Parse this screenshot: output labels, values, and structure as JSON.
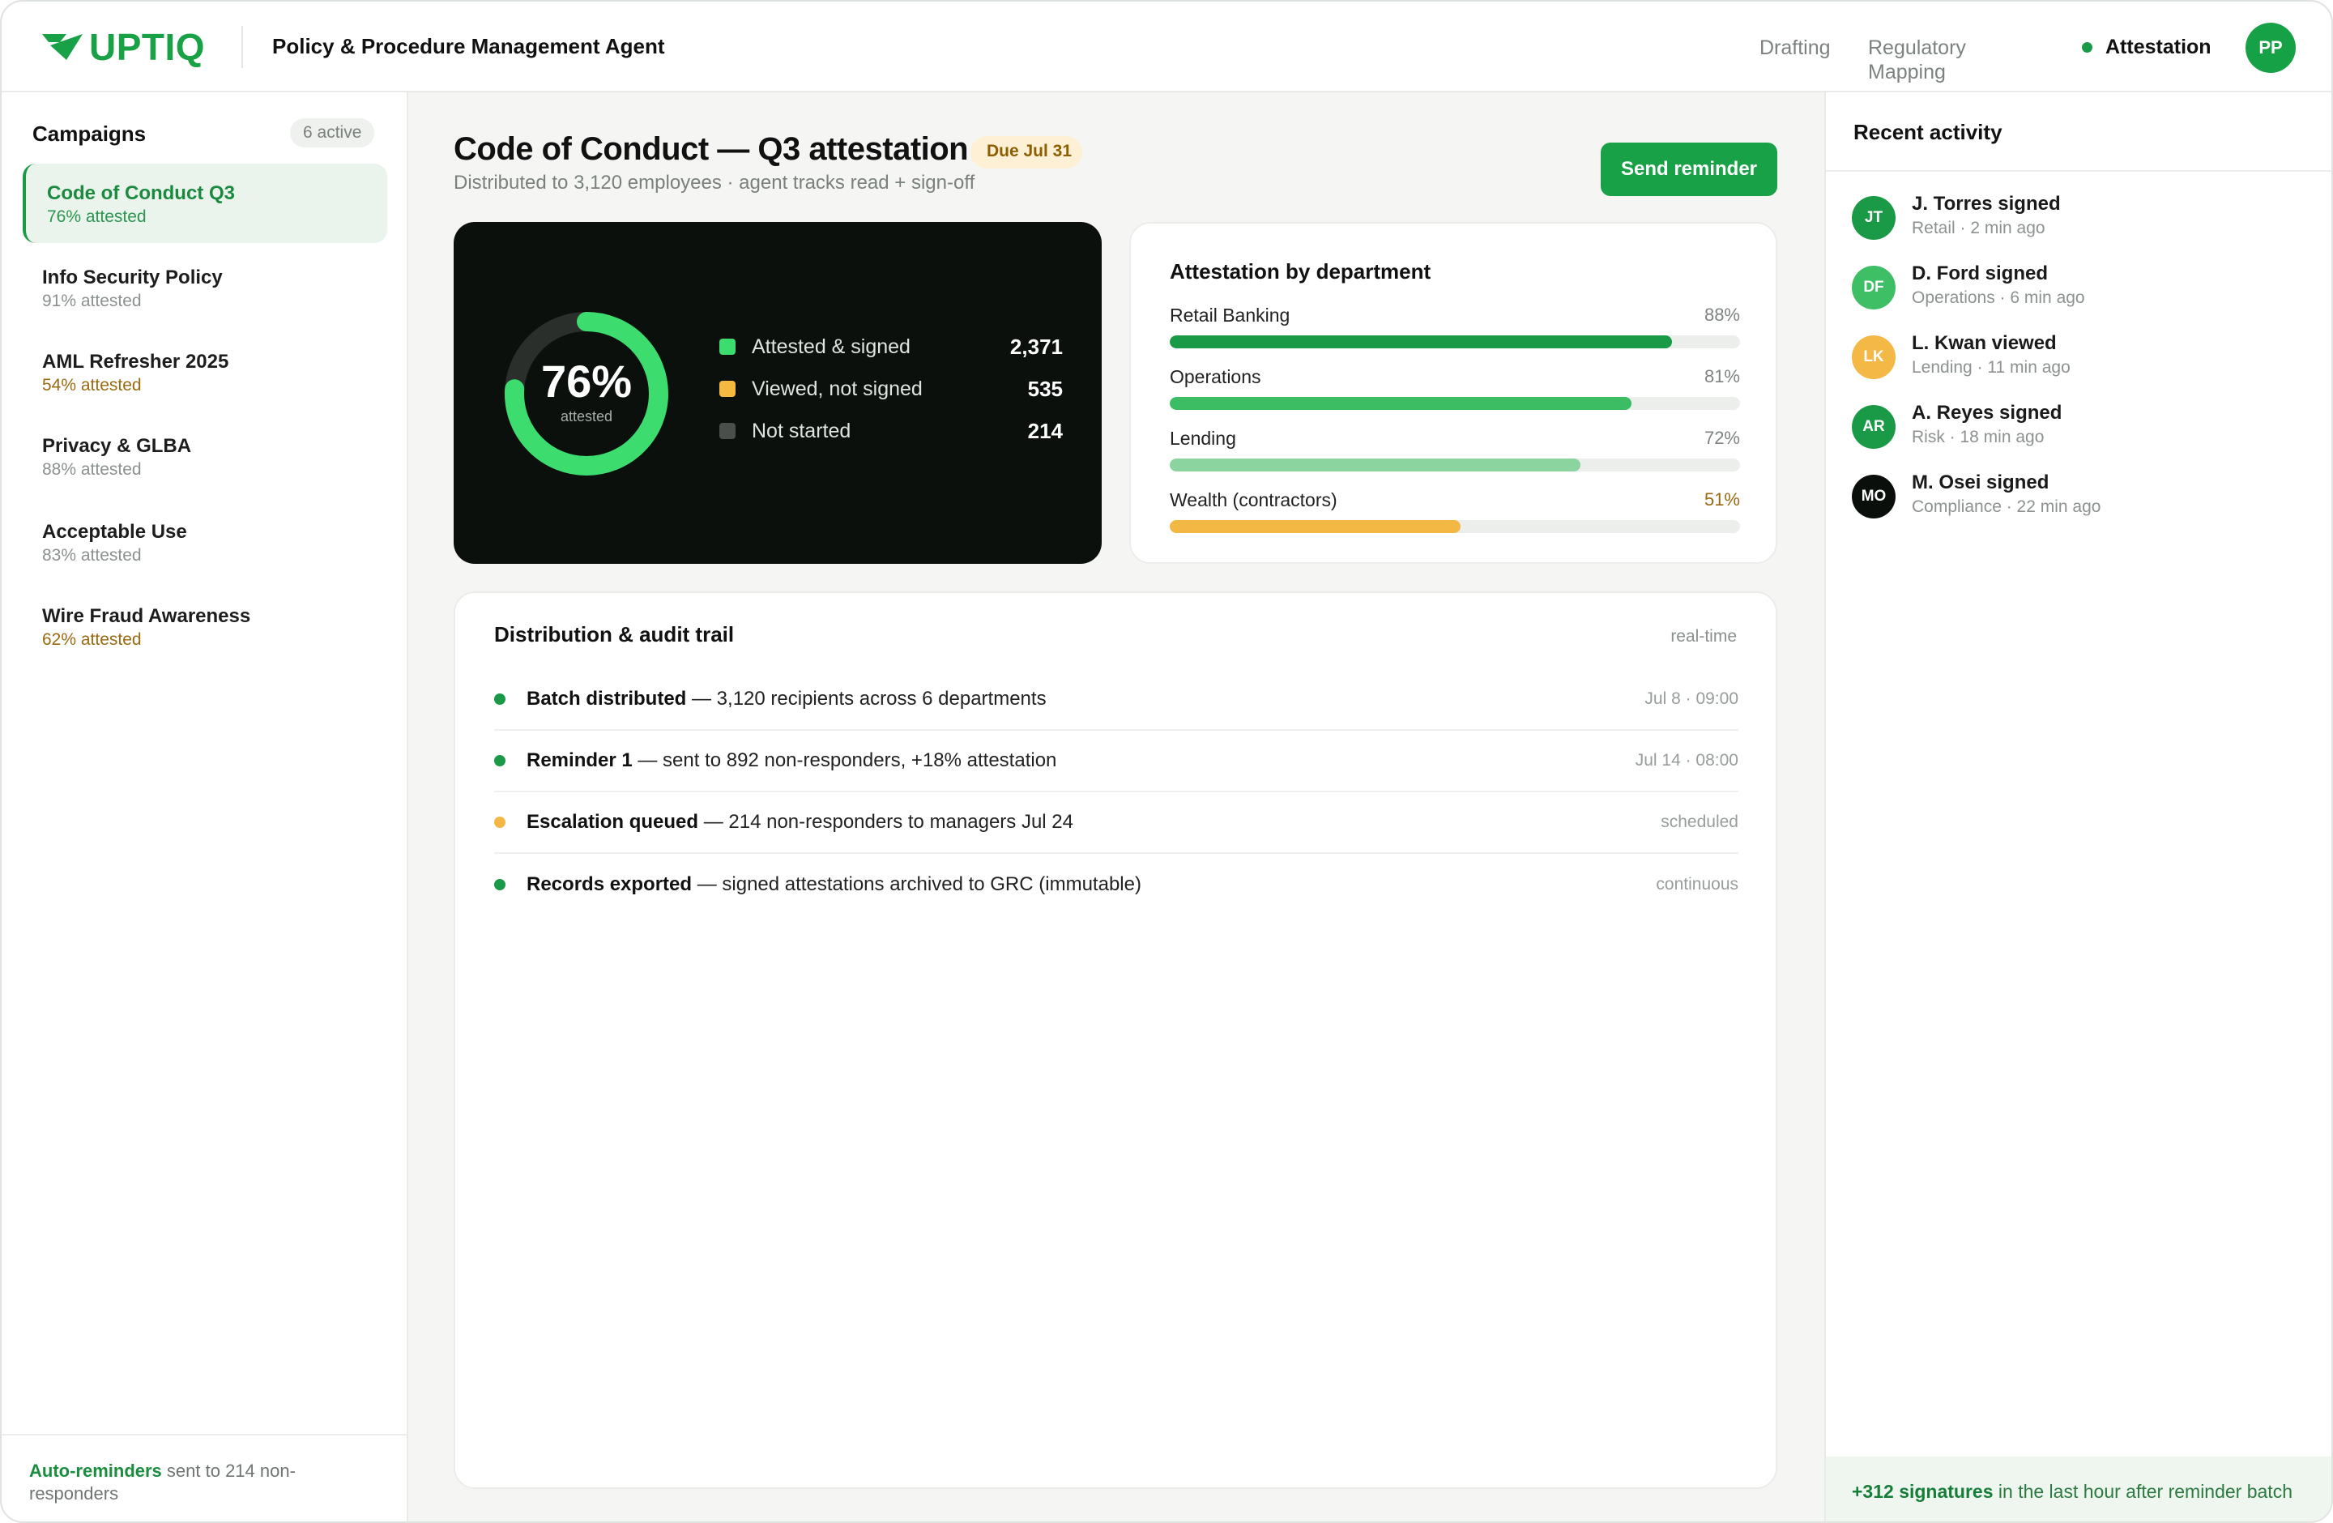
{
  "header": {
    "logo_text": "UPTIQ",
    "app_title": "Policy & Procedure Management Agent",
    "nav": {
      "drafting": "Drafting",
      "regulatory": "Regulatory Mapping",
      "attestation": "Attestation"
    },
    "user_initials": "PP"
  },
  "sidebar": {
    "heading": "Campaigns",
    "badge": "6 active",
    "campaigns": [
      {
        "name": "Code of Conduct Q3",
        "sub": "76% attested"
      },
      {
        "name": "Info Security Policy",
        "sub": "91% attested"
      },
      {
        "name": "AML Refresher 2025",
        "sub": "54% attested"
      },
      {
        "name": "Privacy & GLBA",
        "sub": "88% attested"
      },
      {
        "name": "Acceptable Use",
        "sub": "83% attested"
      },
      {
        "name": "Wire Fraud Awareness",
        "sub": "62% attested"
      }
    ],
    "footer_strong": "Auto-reminders",
    "footer_text": " sent to 214 non-responders"
  },
  "main": {
    "title": "Code of Conduct — Q3 attestation",
    "due": "Due Jul 31",
    "subtitle": "Distributed to 3,120 employees · agent tracks read + sign-off",
    "send_button": "Send reminder",
    "summary": {
      "percent_label": "76%",
      "percent_value": 76,
      "percent_caption": "attested",
      "legend": [
        {
          "label": "Attested & signed",
          "value": "2,371",
          "color": "#3ddc6f"
        },
        {
          "label": "Viewed, not signed",
          "value": "535",
          "color": "#f5b841"
        },
        {
          "label": "Not started",
          "value": "214",
          "color": "#4a4f4c"
        }
      ]
    },
    "departments": {
      "title": "Attestation by department",
      "rows": [
        {
          "name": "Retail Banking",
          "pct_label": "88%",
          "pct": 88,
          "color": "#1a9a46"
        },
        {
          "name": "Operations",
          "pct_label": "81%",
          "pct": 81,
          "color": "#3cbc63"
        },
        {
          "name": "Lending",
          "pct_label": "72%",
          "pct": 72,
          "color": "#8bd4a0"
        },
        {
          "name": "Wealth (contractors)",
          "pct_label": "51%",
          "pct": 51,
          "color": "#f2b843"
        }
      ]
    },
    "audit": {
      "title": "Distribution & audit trail",
      "meta": "real-time",
      "rows": [
        {
          "strong": "Batch distributed",
          "text": " — 3,120 recipients across 6 departments",
          "time": "Jul 8 · 09:00",
          "color": "#1a9a46"
        },
        {
          "strong": "Reminder 1",
          "text": " — sent to 892 non-responders, +18% attestation",
          "time": "Jul 14 · 08:00",
          "color": "#1a9a46"
        },
        {
          "strong": "Escalation queued",
          "text": " — 214 non-responders to managers Jul 24",
          "time": "scheduled",
          "color": "#f2b843"
        },
        {
          "strong": "Records exported",
          "text": " — signed attestations archived to GRC (immutable)",
          "time": "continuous",
          "color": "#1a9a46"
        }
      ]
    }
  },
  "activity": {
    "title": "Recent activity",
    "items": [
      {
        "initials": "JT",
        "name": "J. Torres signed",
        "sub": "Retail · 2 min ago",
        "color": "#1a9a46"
      },
      {
        "initials": "DF",
        "name": "D. Ford signed",
        "sub": "Operations · 6 min ago",
        "color": "#3ebf66"
      },
      {
        "initials": "LK",
        "name": "L. Kwan viewed",
        "sub": "Lending · 11 min ago",
        "color": "#f4b846"
      },
      {
        "initials": "AR",
        "name": "A. Reyes signed",
        "sub": "Risk · 18 min ago",
        "color": "#1a9a46"
      },
      {
        "initials": "MO",
        "name": "M. Osei signed",
        "sub": "Compliance · 22 min ago",
        "color": "#0b0f0c"
      }
    ],
    "footer_strong": "+312 signatures",
    "footer_text": " in the last hour after reminder batch"
  }
}
